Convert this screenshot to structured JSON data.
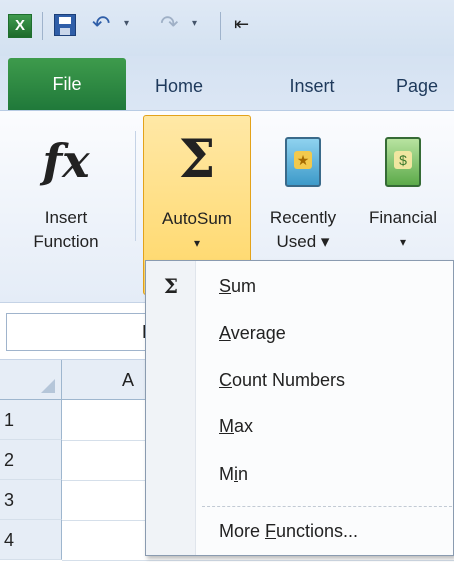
{
  "quick_access": {
    "app_icon_letter": "X",
    "dropdown_glyph": "▾",
    "customize_glyph": "⇤"
  },
  "tabs": [
    {
      "label": "File"
    },
    {
      "label": "Home"
    },
    {
      "label": "Insert"
    },
    {
      "label": "Page"
    }
  ],
  "ribbon": {
    "insert_function": {
      "label_line1": "Insert",
      "label_line2": "Function",
      "glyph": "fx"
    },
    "autosum": {
      "label": "AutoSum",
      "glyph": "Σ",
      "arrow": "▾"
    },
    "recently_used": {
      "label_line1": "Recently",
      "label_line2": "Used ▾"
    },
    "financial": {
      "label_line1": "Financial",
      "label_line2": "▾"
    }
  },
  "name_box": {
    "value": "H"
  },
  "grid": {
    "column_header": "A",
    "rows": [
      "1",
      "2",
      "3",
      "4"
    ]
  },
  "autosum_menu": {
    "items": [
      {
        "pre": "",
        "accel": "S",
        "post": "um",
        "icon": "Σ"
      },
      {
        "pre": "",
        "accel": "A",
        "post": "verage"
      },
      {
        "pre": "",
        "accel": "C",
        "post": "ount Numbers"
      },
      {
        "pre": "",
        "accel": "M",
        "post": "ax"
      },
      {
        "pre": "M",
        "accel": "i",
        "post": "n"
      },
      {
        "pre": "More ",
        "accel": "F",
        "post": "unctions..."
      }
    ]
  },
  "colors": {
    "file_tab": "#2e8b45",
    "autosum_highlight": "#ffd767",
    "ribbon_text": "#1e395b"
  }
}
